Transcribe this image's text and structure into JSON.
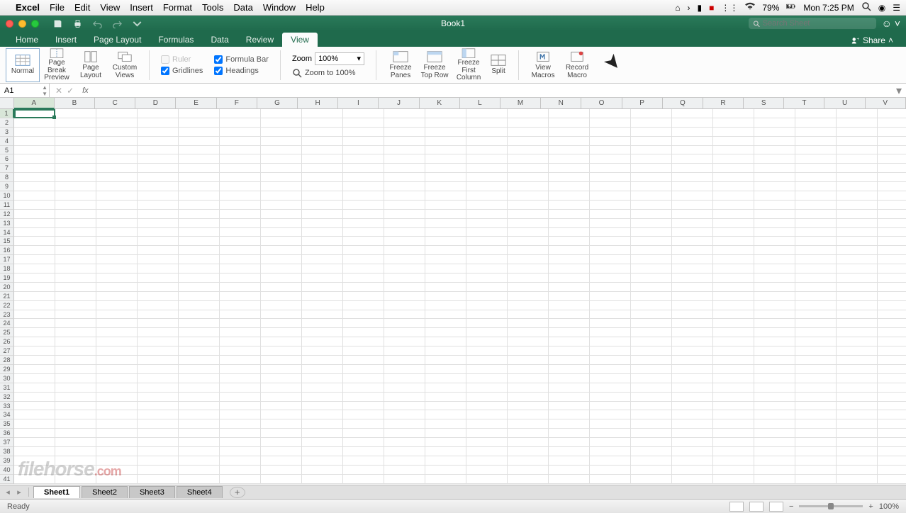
{
  "menubar": {
    "app": "Excel",
    "items": [
      "File",
      "Edit",
      "View",
      "Insert",
      "Format",
      "Tools",
      "Data",
      "Window",
      "Help"
    ],
    "battery": "79%",
    "clock": "Mon 7:25 PM"
  },
  "titlebar": {
    "title": "Book1",
    "search_placeholder": "Search Sheet"
  },
  "tabs": {
    "items": [
      "Home",
      "Insert",
      "Page Layout",
      "Formulas",
      "Data",
      "Review",
      "View"
    ],
    "active": "View",
    "share": "Share"
  },
  "ribbon": {
    "normal": "Normal",
    "page_break": "Page Break\nPreview",
    "page_layout": "Page\nLayout",
    "custom_views": "Custom\nViews",
    "ruler": "Ruler",
    "formula_bar": "Formula Bar",
    "gridlines": "Gridlines",
    "headings": "Headings",
    "zoom_label": "Zoom",
    "zoom_value": "100%",
    "zoom_100": "Zoom to 100%",
    "freeze_panes": "Freeze\nPanes",
    "freeze_top": "Freeze\nTop Row",
    "freeze_first": "Freeze First\nColumn",
    "split": "Split",
    "view_macros": "View\nMacros",
    "record_macro": "Record\nMacro"
  },
  "formula_bar": {
    "name_box": "A1",
    "fx": "fx"
  },
  "columns": [
    "A",
    "B",
    "C",
    "D",
    "E",
    "F",
    "G",
    "H",
    "I",
    "J",
    "K",
    "L",
    "M",
    "N",
    "O",
    "P",
    "Q",
    "R",
    "S",
    "T",
    "U",
    "V"
  ],
  "row_count": 41,
  "sheets": {
    "tabs": [
      "Sheet1",
      "Sheet2",
      "Sheet3",
      "Sheet4"
    ],
    "active": "Sheet1"
  },
  "status": {
    "ready": "Ready",
    "zoom": "100%"
  },
  "watermark": {
    "main": "filehorse",
    "suffix": ".com"
  }
}
